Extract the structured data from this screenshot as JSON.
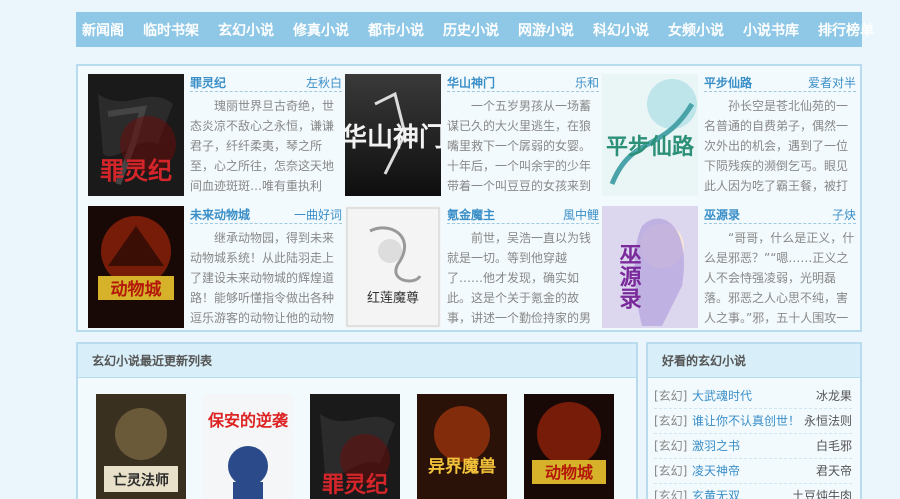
{
  "nav": {
    "items": [
      "新闻阁",
      "临时书架",
      "玄幻小说",
      "修真小说",
      "都市小说",
      "历史小说",
      "网游小说",
      "科幻小说",
      "女频小说",
      "小说书库",
      "排行榜单"
    ]
  },
  "featured": [
    {
      "title": "罪灵纪",
      "author": "左秋白",
      "desc": "瑰丽世界旦古奇绝，世态炎凉不敌心之永恒，谦谦君子，纤纤柔夷，琴之所至，心之所往，怎奈这天地间血迹斑斑…唯有重执利刃，砥砺前行，前路注定孤…",
      "cover_text": "罪灵纪"
    },
    {
      "title": "华山神门",
      "author": "乐和",
      "desc": "一个五岁男孩从一场蓄谋已久的大火里逃生，在狼嘴里救下一个孱弱的女婴。十年后，一个叫余宇的少年带着一个叫豆豆的女孩来到了一个叫圣城的地方。纵火…",
      "cover_text": "华山神门"
    },
    {
      "title": "平步仙路",
      "author": "爱者对半",
      "desc": "孙长空是苍北仙苑的一名普通的自费弟子，偶然一次外出的机会，遇到了一位下陨残疾的濒倒乞丐。眼见此人因为吃了霸王餐，被打的不成样子，孙长空拿出自…",
      "cover_text": "平步仙路"
    },
    {
      "title": "未来动物城",
      "author": "一曲好词",
      "desc": "继承动物园，得到未来动物城系统！从此陆羽走上了建设未来动物城的辉煌道路！能够听懂指令做出各种逗乐游客的动物让他的动物园走出困境！只是这系统有…",
      "cover_text": "动物城"
    },
    {
      "title": "氪金魔主",
      "author": "風中鲤",
      "desc": "前世，吴浩一直以为钱就是一切。等到他穿越了……他才发现，确实如此。这是个关于氪金的故事，讲述一个勤俭持家的男人氪金成为大魔王的传说。…",
      "cover_text": "红莲魔尊"
    },
    {
      "title": "巫源录",
      "author": "子炔",
      "desc": "“哥哥，什么是正义，什么是邪恶？”“嗯……正义之人不会恃强凌弱，光明磊落。邪恶之人心思不纯，害人之事。”邪，五十人围攻一个年暮老人，算什…",
      "cover_text": "巫源录"
    }
  ],
  "latest": {
    "heading": "玄幻小说最近更新列表",
    "covers": [
      "亡灵法师",
      "保安的逆袭",
      "罪灵纪",
      "异界魔兽",
      "动物城"
    ]
  },
  "hot": {
    "heading": "好看的玄幻小说",
    "items": [
      {
        "cat": "[玄幻]",
        "book": "大武魂时代",
        "author": "冰龙果"
      },
      {
        "cat": "[玄幻]",
        "book": "谁让你不认真创世！",
        "author": "永恒法则"
      },
      {
        "cat": "[玄幻]",
        "book": "激羽之书",
        "author": "白毛邪"
      },
      {
        "cat": "[玄幻]",
        "book": "凌天神帝",
        "author": "君天帝"
      },
      {
        "cat": "[玄幻]",
        "book": "玄黄无双",
        "author": "土豆炖牛肉"
      }
    ]
  },
  "colors": {
    "nav": "#8fc8e6",
    "accent": "#3a8fc8",
    "border": "#b8dcee"
  }
}
